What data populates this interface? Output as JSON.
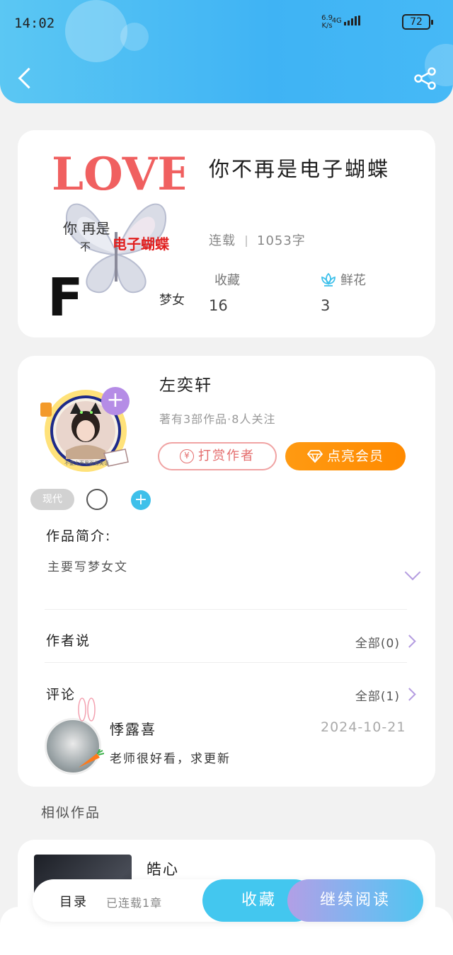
{
  "status_bar": {
    "time": "14:02",
    "net_speed": "6.9",
    "net_unit": "K/s",
    "signal": "4G",
    "battery": "72"
  },
  "book": {
    "title": "你不再是电子蝴蝶",
    "cover_text": {
      "top": "LOVE",
      "line1": "你 再是",
      "line2": "不",
      "red": "电子蝴蝶",
      "corner": "梦女",
      "letter": "F"
    },
    "status": "连载",
    "word_count": "1053字",
    "favorites_label": "收藏",
    "favorites": "16",
    "flowers_label": "鲜花",
    "flowers": "3"
  },
  "author": {
    "name": "左奕轩",
    "subtitle": "著有3部作品·8人关注",
    "tip_button": "打赏作者",
    "tip_icon": "¥",
    "vip_button": "点亮会员",
    "tag": "现代",
    "avatar_caption": "不要大声里面看笑话"
  },
  "intro": {
    "label": "作品简介:",
    "text": "主要写梦女文"
  },
  "author_says": {
    "label": "作者说",
    "more": "全部(0)"
  },
  "comments": {
    "label": "评论",
    "more": "全部(1)",
    "items": [
      {
        "name": "悸露喜",
        "date": "2024-10-21",
        "text": "老师很好看，求更新"
      }
    ]
  },
  "similar": {
    "label": "相似作品",
    "first_title": "皓心"
  },
  "bottom_bar": {
    "toc": "目录",
    "status": "已连载1章",
    "favorite": "收藏",
    "continue": "继续阅读"
  },
  "colors": {
    "header": "#3fb3f4",
    "accent_purple": "#b49ce0",
    "vip_orange": "#ff9a12",
    "fav_blue": "#43c7ef",
    "tip_red": "#e46d6d"
  }
}
